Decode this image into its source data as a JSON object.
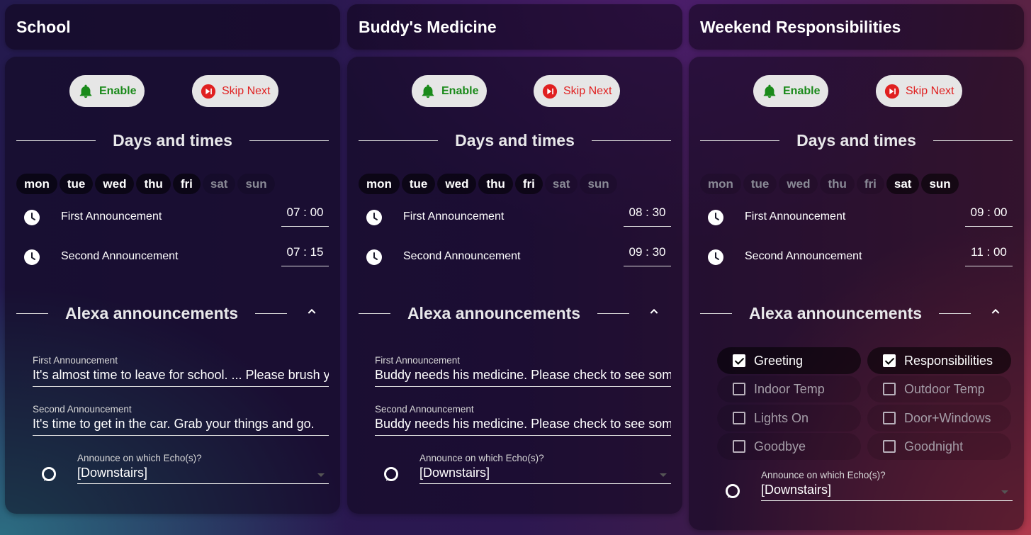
{
  "buttons": {
    "enable": "Enable",
    "skip_next": "Skip Next"
  },
  "sections": {
    "days_times": "Days and times",
    "alexa": "Alexa announcements"
  },
  "cards": [
    {
      "title": "School",
      "days": [
        {
          "label": "mon",
          "on": true
        },
        {
          "label": "tue",
          "on": true
        },
        {
          "label": "wed",
          "on": true
        },
        {
          "label": "thu",
          "on": true
        },
        {
          "label": "fri",
          "on": true
        },
        {
          "label": "sat",
          "on": false
        },
        {
          "label": "sun",
          "on": false
        }
      ],
      "times": [
        {
          "label": "First Announcement",
          "value": "07 : 00"
        },
        {
          "label": "Second Announcement",
          "value": "07 : 15"
        }
      ],
      "announcements": [
        {
          "label": "First Announcement",
          "value": "It's almost time to leave for school. ... Please brush y"
        },
        {
          "label": "Second Announcement",
          "value": "It's time to get in the car. Grab your things and go."
        }
      ],
      "echo": {
        "label": "Announce on which Echo(s)?",
        "value": "[Downstairs]"
      }
    },
    {
      "title": "Buddy's Medicine",
      "days": [
        {
          "label": "mon",
          "on": true
        },
        {
          "label": "tue",
          "on": true
        },
        {
          "label": "wed",
          "on": true
        },
        {
          "label": "thu",
          "on": true
        },
        {
          "label": "fri",
          "on": true
        },
        {
          "label": "sat",
          "on": false
        },
        {
          "label": "sun",
          "on": false
        }
      ],
      "times": [
        {
          "label": "First Announcement",
          "value": "08 : 30"
        },
        {
          "label": "Second Announcement",
          "value": "09 : 30"
        }
      ],
      "announcements": [
        {
          "label": "First Announcement",
          "value": "Buddy needs his medicine. Please check to see som"
        },
        {
          "label": "Second Announcement",
          "value": "Buddy needs his medicine. Please check to see som"
        }
      ],
      "echo": {
        "label": "Announce on which Echo(s)?",
        "value": "[Downstairs]"
      }
    },
    {
      "title": "Weekend Responsibilities",
      "days": [
        {
          "label": "mon",
          "on": false
        },
        {
          "label": "tue",
          "on": false
        },
        {
          "label": "wed",
          "on": false
        },
        {
          "label": "thu",
          "on": false
        },
        {
          "label": "fri",
          "on": false
        },
        {
          "label": "sat",
          "on": true
        },
        {
          "label": "sun",
          "on": true
        }
      ],
      "times": [
        {
          "label": "First Announcement",
          "value": "09 : 00"
        },
        {
          "label": "Second Announcement",
          "value": "11 : 00"
        }
      ],
      "options": [
        {
          "label": "Greeting",
          "checked": true
        },
        {
          "label": "Responsibilities",
          "checked": true
        },
        {
          "label": "Indoor Temp",
          "checked": false
        },
        {
          "label": "Outdoor Temp",
          "checked": false
        },
        {
          "label": "Lights On",
          "checked": false
        },
        {
          "label": "Door+Windows",
          "checked": false
        },
        {
          "label": "Goodbye",
          "checked": false
        },
        {
          "label": "Goodnight",
          "checked": false
        }
      ],
      "echo": {
        "label": "Announce on which Echo(s)?",
        "value": "[Downstairs]"
      }
    }
  ],
  "icons": {
    "enable": "bell-icon",
    "skip": "skip-next-icon",
    "clock": "clock-icon",
    "collapse": "chevron-up-icon",
    "alexa": "alexa-ring-icon"
  },
  "colors": {
    "enable": "#1a8a1a",
    "skip": "#e02020",
    "button_bg": "#e6e6e6"
  }
}
